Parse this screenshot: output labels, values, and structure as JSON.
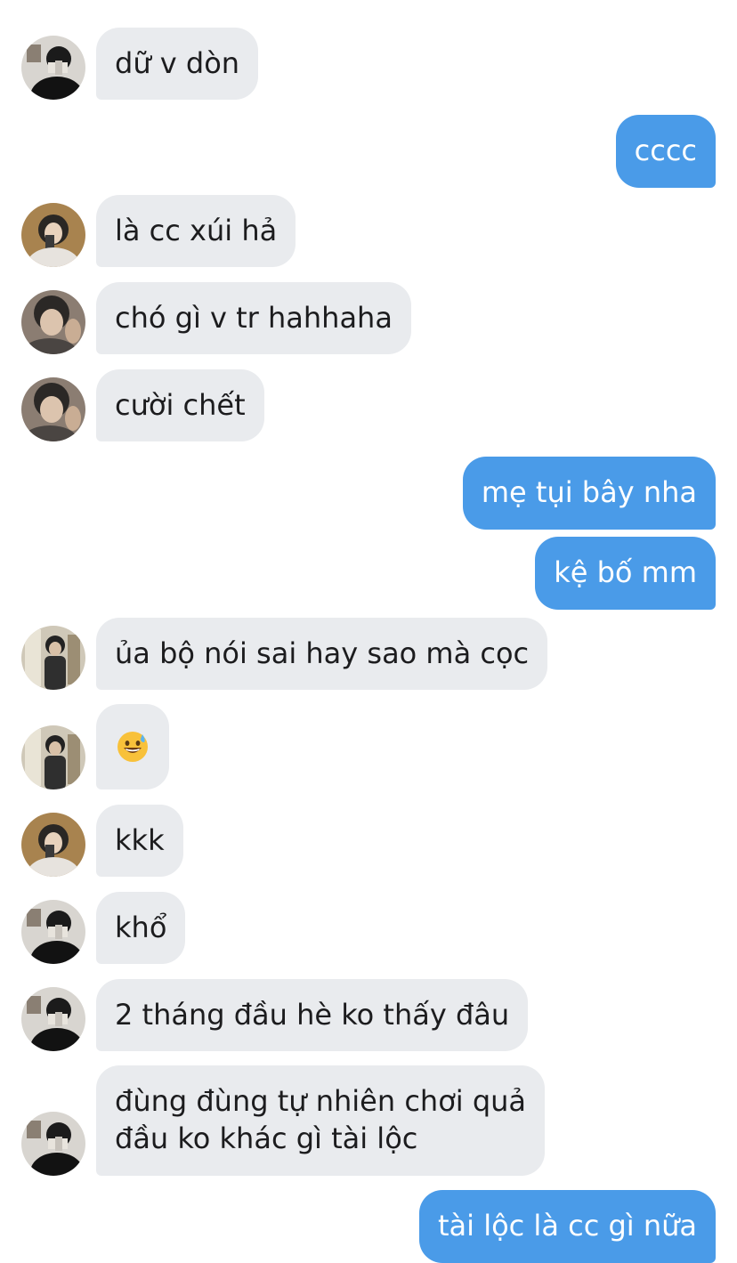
{
  "conversation": {
    "messages": [
      {
        "sender": "other",
        "avatar": "avatar-a",
        "text": "dữ v dòn"
      },
      {
        "sender": "me",
        "text": "cccc"
      },
      {
        "sender": "other",
        "avatar": "avatar-b",
        "text": "là cc xúi hả"
      },
      {
        "sender": "other",
        "avatar": "avatar-c",
        "text": "chó gì v tr hahhaha"
      },
      {
        "sender": "other",
        "avatar": "avatar-c",
        "text": "cười chết"
      },
      {
        "sender": "me",
        "text": "mẹ tụi bây nha"
      },
      {
        "sender": "me",
        "text": "kệ bố mm"
      },
      {
        "sender": "other",
        "avatar": "avatar-d",
        "text": "ủa bộ nói sai hay sao mà cọc"
      },
      {
        "sender": "other",
        "avatar": "avatar-d",
        "emoji": "grinning-face-with-sweat-emoji"
      },
      {
        "sender": "other",
        "avatar": "avatar-b",
        "text": "kkk"
      },
      {
        "sender": "other",
        "avatar": "avatar-a",
        "text": "khổ"
      },
      {
        "sender": "other",
        "avatar": "avatar-a",
        "text": "2 tháng đầu hè ko thấy đâu"
      },
      {
        "sender": "other",
        "avatar": "avatar-a",
        "text_line1": "đùng đùng tự nhiên chơi quả",
        "text_line2": "đầu ko khác gì tài lộc"
      },
      {
        "sender": "me",
        "text": "tài lộc là cc gì nữa"
      }
    ]
  },
  "colors": {
    "incoming_bubble": "#e9ebee",
    "outgoing_bubble": "#4a9be8",
    "incoming_text": "#1c1c1e",
    "outgoing_text": "#ffffff"
  }
}
